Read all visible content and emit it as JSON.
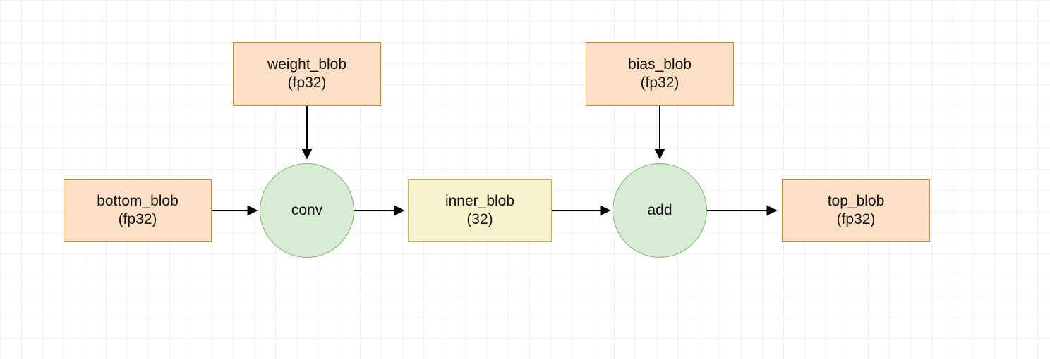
{
  "nodes": {
    "bottom_blob": {
      "label": "bottom_blob",
      "sub": "(fp32)"
    },
    "weight_blob": {
      "label": "weight_blob",
      "sub": "(fp32)"
    },
    "conv": {
      "label": "conv"
    },
    "inner_blob": {
      "label": "inner_blob",
      "sub": "(32)"
    },
    "bias_blob": {
      "label": "bias_blob",
      "sub": "(fp32)"
    },
    "add": {
      "label": "add"
    },
    "top_blob": {
      "label": "top_blob",
      "sub": "(fp32)"
    }
  },
  "edges": [
    {
      "from": "bottom_blob",
      "to": "conv"
    },
    {
      "from": "weight_blob",
      "to": "conv"
    },
    {
      "from": "conv",
      "to": "inner_blob"
    },
    {
      "from": "inner_blob",
      "to": "add"
    },
    {
      "from": "bias_blob",
      "to": "add"
    },
    {
      "from": "add",
      "to": "top_blob"
    }
  ],
  "chart_data": {
    "type": "flow-diagram",
    "nodes": [
      {
        "id": "bottom_blob",
        "label": "bottom_blob",
        "dtype": "fp32",
        "kind": "tensor"
      },
      {
        "id": "weight_blob",
        "label": "weight_blob",
        "dtype": "fp32",
        "kind": "tensor"
      },
      {
        "id": "conv",
        "label": "conv",
        "kind": "op"
      },
      {
        "id": "inner_blob",
        "label": "inner_blob",
        "dtype": "32",
        "kind": "tensor"
      },
      {
        "id": "bias_blob",
        "label": "bias_blob",
        "dtype": "fp32",
        "kind": "tensor"
      },
      {
        "id": "add",
        "label": "add",
        "kind": "op"
      },
      {
        "id": "top_blob",
        "label": "top_blob",
        "dtype": "fp32",
        "kind": "tensor"
      }
    ],
    "edges": [
      {
        "from": "bottom_blob",
        "to": "conv"
      },
      {
        "from": "weight_blob",
        "to": "conv"
      },
      {
        "from": "conv",
        "to": "inner_blob"
      },
      {
        "from": "inner_blob",
        "to": "add"
      },
      {
        "from": "bias_blob",
        "to": "add"
      },
      {
        "from": "add",
        "to": "top_blob"
      }
    ]
  }
}
